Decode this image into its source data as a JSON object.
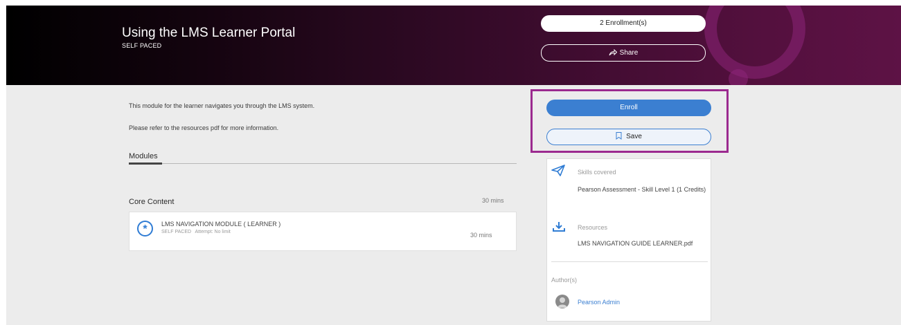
{
  "course": {
    "title": "Using the LMS Learner Portal",
    "type": "SELF PACED"
  },
  "actions": {
    "enrollments": "2 Enrollment(s)",
    "share": "Share",
    "enroll": "Enroll",
    "save": "Save"
  },
  "description": {
    "line1": "This module for the learner navigates you through the LMS system.",
    "line2": "Please refer to the resources pdf for more information."
  },
  "tabs": {
    "modules": "Modules"
  },
  "section": {
    "title": "Core Content",
    "duration": "30 mins"
  },
  "module": {
    "name": "LMS NAVIGATION MODULE ( LEARNER )",
    "type": "SELF PACED",
    "attempt": "Attempt: No limit",
    "duration": "30 mins"
  },
  "sidebar": {
    "skills_label": "Skills covered",
    "skills_value": "Pearson Assessment - Skill Level 1 (1 Credits)",
    "resources_label": "Resources",
    "resources_value": "LMS NAVIGATION GUIDE LEARNER.pdf",
    "authors_label": "Author(s)",
    "author_name": "Pearson Admin"
  },
  "colors": {
    "accent": "#3b7fd1",
    "highlight": "#9b2a8f",
    "banner_end": "#5d1245"
  },
  "icons": [
    "share-icon",
    "bookmark-icon",
    "paper-plane-icon",
    "download-icon",
    "asterisk-icon",
    "user-avatar-icon"
  ]
}
